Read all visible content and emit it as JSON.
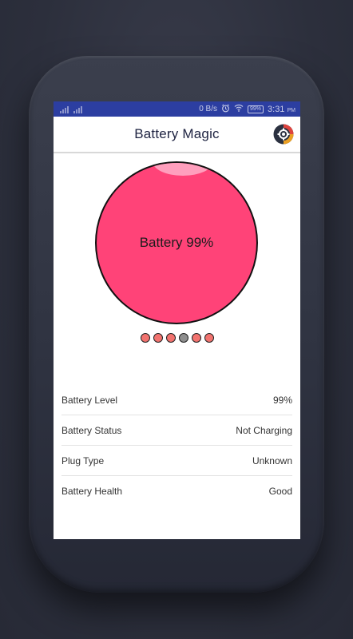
{
  "statusbar": {
    "speed": "0 B/s",
    "battery_badge": "99%",
    "time": "3:31",
    "ampm": "PM",
    "icons": [
      "signal-icon",
      "signal-icon",
      "alarm-icon",
      "wifi-icon",
      "battery-icon"
    ]
  },
  "appbar": {
    "title": "Battery Magic",
    "settings_icon": "gear-wheel-icon"
  },
  "gauge": {
    "label": "Battery 99%",
    "level": 0.99,
    "fill_color": "#ff4378",
    "highlight_color": "#ff9fbd"
  },
  "pager": {
    "count": 6,
    "active_index": 3,
    "dot_color": "#f2736f",
    "active_color": "#8e8e8e"
  },
  "info": {
    "rows": [
      {
        "label": "Battery Level",
        "value": "99%"
      },
      {
        "label": "Battery Status",
        "value": "Not Charging"
      },
      {
        "label": "Plug Type",
        "value": "Unknown"
      },
      {
        "label": "Battery Health",
        "value": "Good"
      }
    ]
  },
  "colors": {
    "statusbar": "#2c3ea1",
    "background": "#2f3240"
  }
}
